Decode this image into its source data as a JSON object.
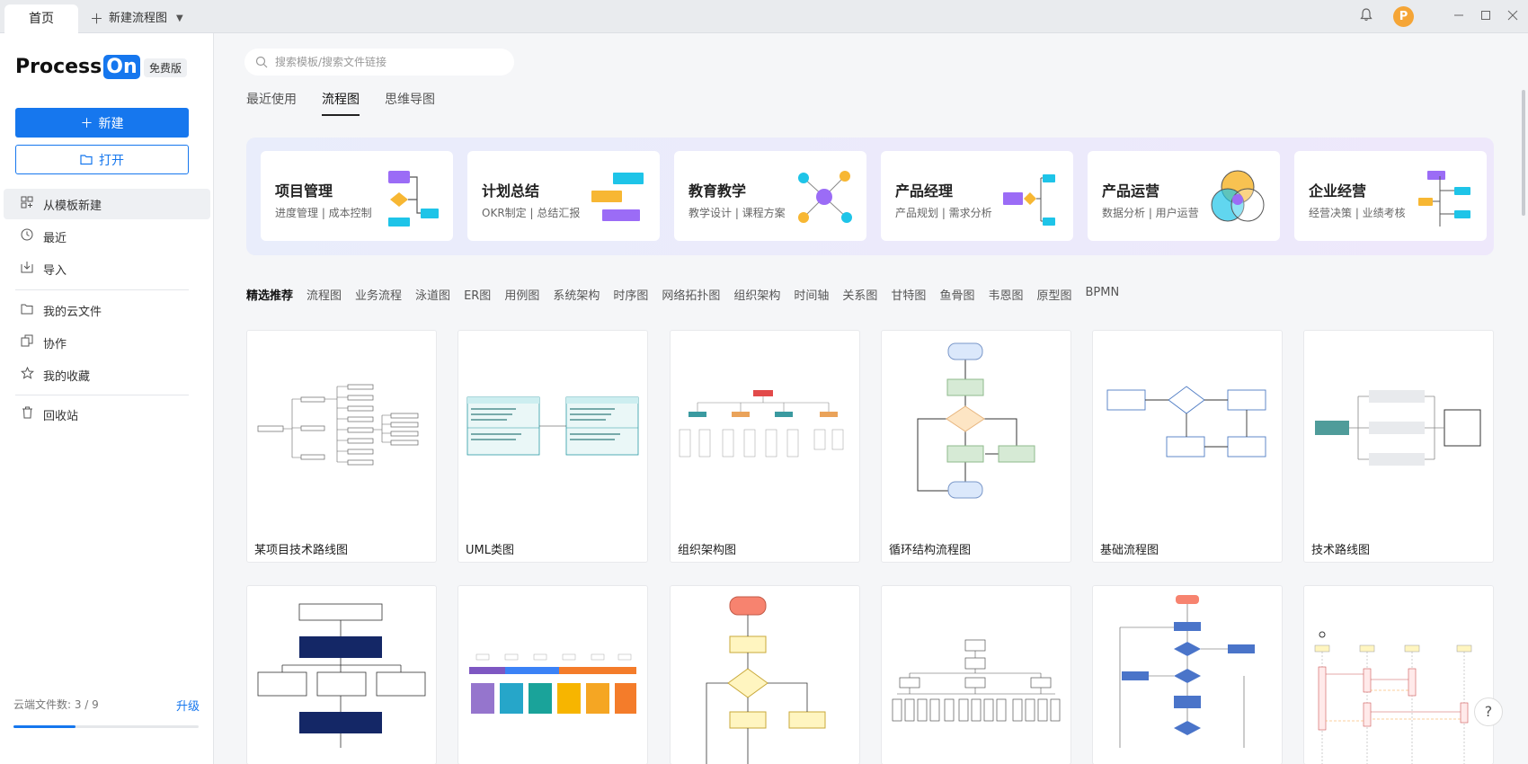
{
  "titlebar": {
    "home_tab": "首页",
    "new_tab": "新建流程图",
    "avatar_letter": "P"
  },
  "sidebar": {
    "logo_text": "Process",
    "logo_badge": "On",
    "plan_badge": "免费版",
    "new_button": "新建",
    "open_button": "打开",
    "items": [
      {
        "label": "从模板新建",
        "icon": "template-icon"
      },
      {
        "label": "最近",
        "icon": "clock-icon"
      },
      {
        "label": "导入",
        "icon": "import-icon"
      },
      {
        "label": "我的云文件",
        "icon": "folder-icon"
      },
      {
        "label": "协作",
        "icon": "collab-icon"
      },
      {
        "label": "我的收藏",
        "icon": "star-icon"
      },
      {
        "label": "回收站",
        "icon": "trash-icon"
      }
    ],
    "storage_label": "云端文件数: 3 / 9",
    "storage_fraction": 0.333,
    "upgrade_label": "升级"
  },
  "search": {
    "placeholder": "搜索模板/搜索文件链接"
  },
  "tabs": [
    "最近使用",
    "流程图",
    "思维导图"
  ],
  "categories": [
    {
      "title": "项目管理",
      "subtitle": "进度管理 | 成本控制"
    },
    {
      "title": "计划总结",
      "subtitle": "OKR制定 | 总结汇报"
    },
    {
      "title": "教育教学",
      "subtitle": "教学设计 | 课程方案"
    },
    {
      "title": "产品经理",
      "subtitle": "产品规划 | 需求分析"
    },
    {
      "title": "产品运营",
      "subtitle": "数据分析 | 用户运营"
    },
    {
      "title": "企业经营",
      "subtitle": "经营决策 | 业绩考核"
    }
  ],
  "filters": [
    "精选推荐",
    "流程图",
    "业务流程",
    "泳道图",
    "ER图",
    "用例图",
    "系统架构",
    "时序图",
    "网络拓扑图",
    "组织架构",
    "时间轴",
    "关系图",
    "甘特图",
    "鱼骨图",
    "韦恩图",
    "原型图",
    "BPMN"
  ],
  "templates": [
    "某项目技术路线图",
    "UML类图",
    "组织架构图",
    "循环结构流程图",
    "基础流程图",
    "技术路线图"
  ],
  "colors": {
    "accent": "#1677ee",
    "avatar": "#f5a536"
  }
}
